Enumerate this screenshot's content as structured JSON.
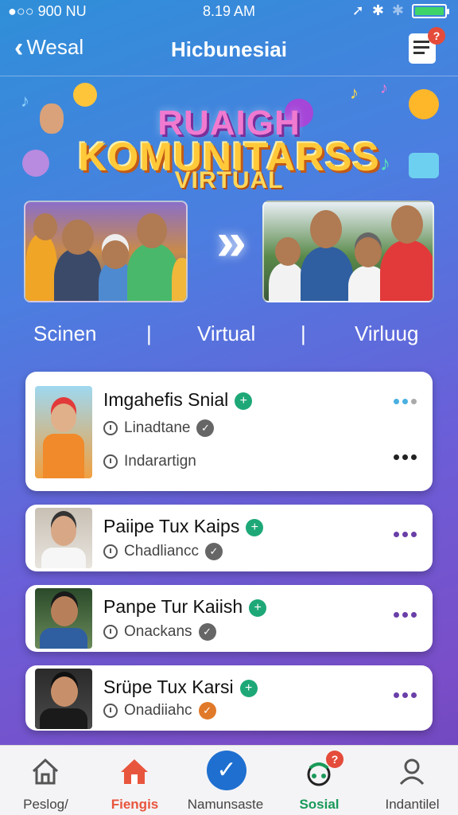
{
  "status": {
    "left": "●○○ 900 NU",
    "time": "8.19 AM",
    "battery_level": 1.0
  },
  "header": {
    "back_label": "Wesal",
    "title": "Hicbunesiai",
    "notif_badge": "?"
  },
  "hero": {
    "line1": "RUAIGH",
    "line2": "KOMUNITARSS",
    "line3": "VIRTUAL"
  },
  "tabs": [
    "Scinen",
    "Virtual",
    "Virluug"
  ],
  "tab_separator": "|",
  "cards": [
    {
      "name": "Imgahefis Snial",
      "sub1": "Linadtane",
      "sub2": "Indarartign"
    },
    {
      "name": "Paiipe Tux Kaips",
      "sub1": "Chadliancc"
    },
    {
      "name": "Panpe Tur Kaiish",
      "sub1": "Onackans"
    },
    {
      "name": "Srüpe Tux Karsi",
      "sub1": "Onadiiahc"
    }
  ],
  "nav": [
    {
      "label": "Peslog/",
      "icon": "home-outline-icon"
    },
    {
      "label": "Fiengis",
      "icon": "home-filled-icon"
    },
    {
      "label": "Namunsaste",
      "icon": "check-circle-icon"
    },
    {
      "label": "Sosial",
      "icon": "social-chat-icon",
      "badge": "?"
    },
    {
      "label": "Indantilel",
      "icon": "person-icon"
    }
  ],
  "colors": {
    "accent_red": "#e44b3a",
    "accent_green": "#1ea878",
    "accent_blue": "#1f6fd0",
    "nav_active_red": "#e8553d",
    "nav_active_green": "#1a9a5a"
  }
}
